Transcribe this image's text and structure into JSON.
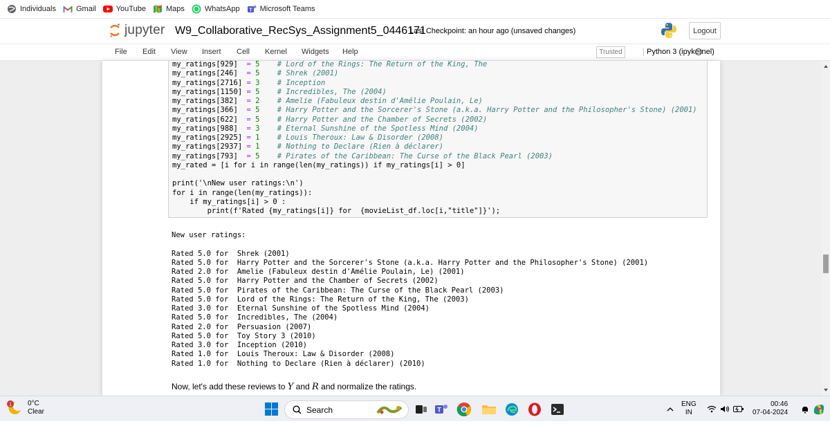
{
  "bookmarks": [
    {
      "label": "Individuals",
      "icon": "globe-icon"
    },
    {
      "label": "Gmail",
      "icon": "gmail-icon"
    },
    {
      "label": "YouTube",
      "icon": "youtube-icon"
    },
    {
      "label": "Maps",
      "icon": "maps-icon"
    },
    {
      "label": "WhatsApp",
      "icon": "whatsapp-icon"
    },
    {
      "label": "Microsoft Teams",
      "icon": "teams-icon"
    }
  ],
  "header": {
    "logo_text": "jupyter",
    "notebook_name": "W9_Collaborative_RecSys_Assignment5_0446171",
    "checkpoint": "Last Checkpoint: an hour ago  (unsaved changes)",
    "logout_label": "Logout"
  },
  "menu": {
    "items": [
      "File",
      "Edit",
      "View",
      "Insert",
      "Cell",
      "Kernel",
      "Widgets",
      "Help"
    ],
    "trusted": "Trusted",
    "kernel": "Python 3 (ipykernel)"
  },
  "code_lines": [
    {
      "a": "my_ratings[929]  = 5",
      "c": "# Lord of the Rings: The Return of the King, The"
    },
    {
      "a": "my_ratings[246]  = 5",
      "c": "# Shrek (2001)"
    },
    {
      "a": "my_ratings[2716] = 3",
      "c": "# Inception"
    },
    {
      "a": "my_ratings[1150] = 5",
      "c": "# Incredibles, The (2004)"
    },
    {
      "a": "my_ratings[382]  = 2",
      "c": "# Amelie (Fabuleux destin d'Amélie Poulain, Le)"
    },
    {
      "a": "my_ratings[366]  = 5",
      "c": "# Harry Potter and the Sorcerer's Stone (a.k.a. Harry Potter and the Philosopher's Stone) (2001)"
    },
    {
      "a": "my_ratings[622]  = 5",
      "c": "# Harry Potter and the Chamber of Secrets (2002)"
    },
    {
      "a": "my_ratings[988]  = 3",
      "c": "# Eternal Sunshine of the Spotless Mind (2004)"
    },
    {
      "a": "my_ratings[2925] = 1",
      "c": "# Louis Theroux: Law & Disorder (2008)"
    },
    {
      "a": "my_ratings[2937] = 1",
      "c": "# Nothing to Declare (Rien à déclarer)"
    },
    {
      "a": "my_ratings[793]  = 5",
      "c": "# Pirates of the Caribbean: The Curse of the Black Pearl (2003)"
    }
  ],
  "code_tail": {
    "rated_line": "my_rated = [i for i in range(len(my_ratings)) if my_ratings[i] > 0]",
    "print1": "print('\\nNew user ratings:\\n')",
    "for_line": "for i in range(len(my_ratings)):",
    "if_line": "    if my_ratings[i] > 0 :",
    "print2": "        print(f'Rated {my_ratings[i]} for  {movieList_df.loc[i,\"title\"]}');"
  },
  "output": {
    "heading": "New user ratings:",
    "rows": [
      {
        "rating": "5.0",
        "title": "Shrek (2001)"
      },
      {
        "rating": "5.0",
        "title": "Harry Potter and the Sorcerer's Stone (a.k.a. Harry Potter and the Philosopher's Stone) (2001)"
      },
      {
        "rating": "2.0",
        "title": "Amelie (Fabuleux destin d'Amélie Poulain, Le) (2001)"
      },
      {
        "rating": "5.0",
        "title": "Harry Potter and the Chamber of Secrets (2002)"
      },
      {
        "rating": "5.0",
        "title": "Pirates of the Caribbean: The Curse of the Black Pearl (2003)"
      },
      {
        "rating": "5.0",
        "title": "Lord of the Rings: The Return of the King, The (2003)"
      },
      {
        "rating": "3.0",
        "title": "Eternal Sunshine of the Spotless Mind (2004)"
      },
      {
        "rating": "5.0",
        "title": "Incredibles, The (2004)"
      },
      {
        "rating": "2.0",
        "title": "Persuasion (2007)"
      },
      {
        "rating": "5.0",
        "title": "Toy Story 3 (2010)"
      },
      {
        "rating": "3.0",
        "title": "Inception (2010)"
      },
      {
        "rating": "1.0",
        "title": "Louis Theroux: Law & Disorder (2008)"
      },
      {
        "rating": "1.0",
        "title": "Nothing to Declare (Rien à déclarer) (2010)"
      }
    ],
    "rated_word": "Rated",
    "for_word": "for"
  },
  "markdown": {
    "pre": "Now, let's add these reviews to ",
    "y": "Y",
    "mid": " and ",
    "r": "R",
    "post": " and normalize the ratings."
  },
  "taskbar": {
    "badge": "1",
    "temp": "0°C",
    "weather": "Clear",
    "search": "Search",
    "lang1": "ENG",
    "lang2": "IN",
    "time": "00:46",
    "date": "07-04-2024"
  }
}
